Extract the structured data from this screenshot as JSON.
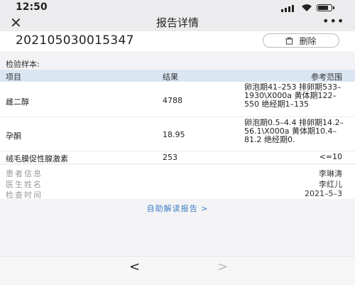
{
  "status_bar": {
    "time": "12:50",
    "battery_level": 0.85
  },
  "nav": {
    "close_symbol": "✕",
    "title": "报告详情",
    "more_symbol": "•••"
  },
  "report": {
    "id": "202105030015347",
    "delete_label": "删除"
  },
  "section": {
    "sample_label": "检验样本:"
  },
  "table": {
    "headers": {
      "name": "项目",
      "result": "结果",
      "reference": "参考范围"
    },
    "rows": [
      {
        "name": "雌二醇",
        "result": "4788",
        "reference": "卵泡期41–253 排卵期533–1930\\X000a 黄体期122–550 绝经期1–135"
      },
      {
        "name": "孕酮",
        "result": "18.95",
        "reference": "卵泡期0.5–4.4 排卵期14.2–56.1\\X000a 黄体期10.4–81.2 绝经期0."
      },
      {
        "name": "绒毛膜促性腺激素",
        "result": "253",
        "reference": "<=10"
      }
    ]
  },
  "info": [
    {
      "label": "患者信息",
      "value": "李琳涛"
    },
    {
      "label": "医生姓名",
      "value": "李红儿"
    },
    {
      "label": "检查时间",
      "value": "2021–5–3"
    }
  ],
  "self_read_link": "自助解读报告 >",
  "bottom_nav": {
    "back": "<",
    "forward": ">"
  },
  "icons": {
    "close": "close-icon",
    "more": "more-icon",
    "trash": "trash-icon",
    "back": "back-arrow-icon",
    "forward": "forward-arrow-icon"
  },
  "colors": {
    "link": "#3f7fc4",
    "table_header_bg": "#dbe6f3"
  }
}
